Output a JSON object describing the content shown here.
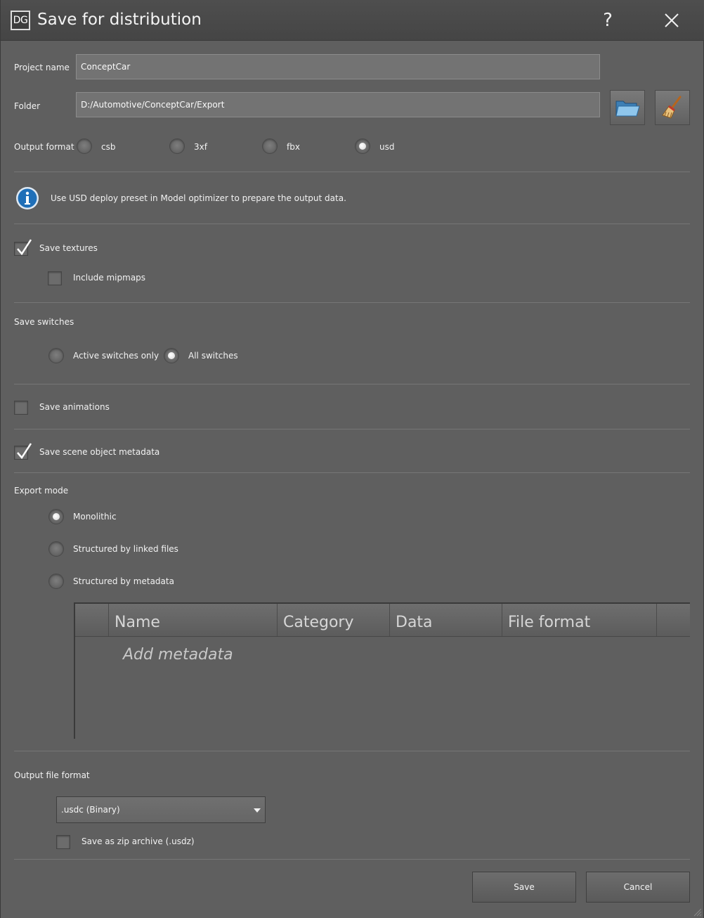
{
  "window": {
    "app_icon": "DG",
    "title": "Save for distribution",
    "help": "?"
  },
  "project": {
    "label": "Project name",
    "value": "ConceptCar"
  },
  "folder": {
    "label": "Folder",
    "value": "D:/Automotive/ConceptCar/Export"
  },
  "output_format": {
    "label": "Output format",
    "options": [
      "csb",
      "3xf",
      "fbx",
      "usd"
    ],
    "selected": "usd"
  },
  "info": {
    "text": "Use USD deploy preset in Model optimizer to prepare the output data."
  },
  "textures": {
    "save_label": "Save textures",
    "save_checked": true,
    "mipmaps_label": "Include mipmaps",
    "mipmaps_checked": false
  },
  "switches": {
    "label": "Save switches",
    "options": [
      "Active switches only",
      "All switches"
    ],
    "selected": "All switches"
  },
  "animations": {
    "label": "Save animations",
    "checked": false
  },
  "metadata": {
    "label": "Save scene object metadata",
    "checked": true
  },
  "export_mode": {
    "label": "Export mode",
    "options": [
      "Monolithic",
      "Structured by linked files",
      "Structured by metadata"
    ],
    "selected": "Monolithic"
  },
  "meta_table": {
    "columns": [
      "Name",
      "Category",
      "Data",
      "File format"
    ],
    "placeholder": "Add metadata"
  },
  "output_file_format": {
    "label": "Output file format",
    "value": ".usdc (Binary)"
  },
  "zip": {
    "label": "Save as zip archive (.usdz)",
    "checked": false
  },
  "buttons": {
    "save": "Save",
    "cancel": "Cancel"
  },
  "colors": {
    "background": "#5f5f5f",
    "titlebar": "#4a4a4a",
    "info_blue": "#1f6fb8"
  }
}
